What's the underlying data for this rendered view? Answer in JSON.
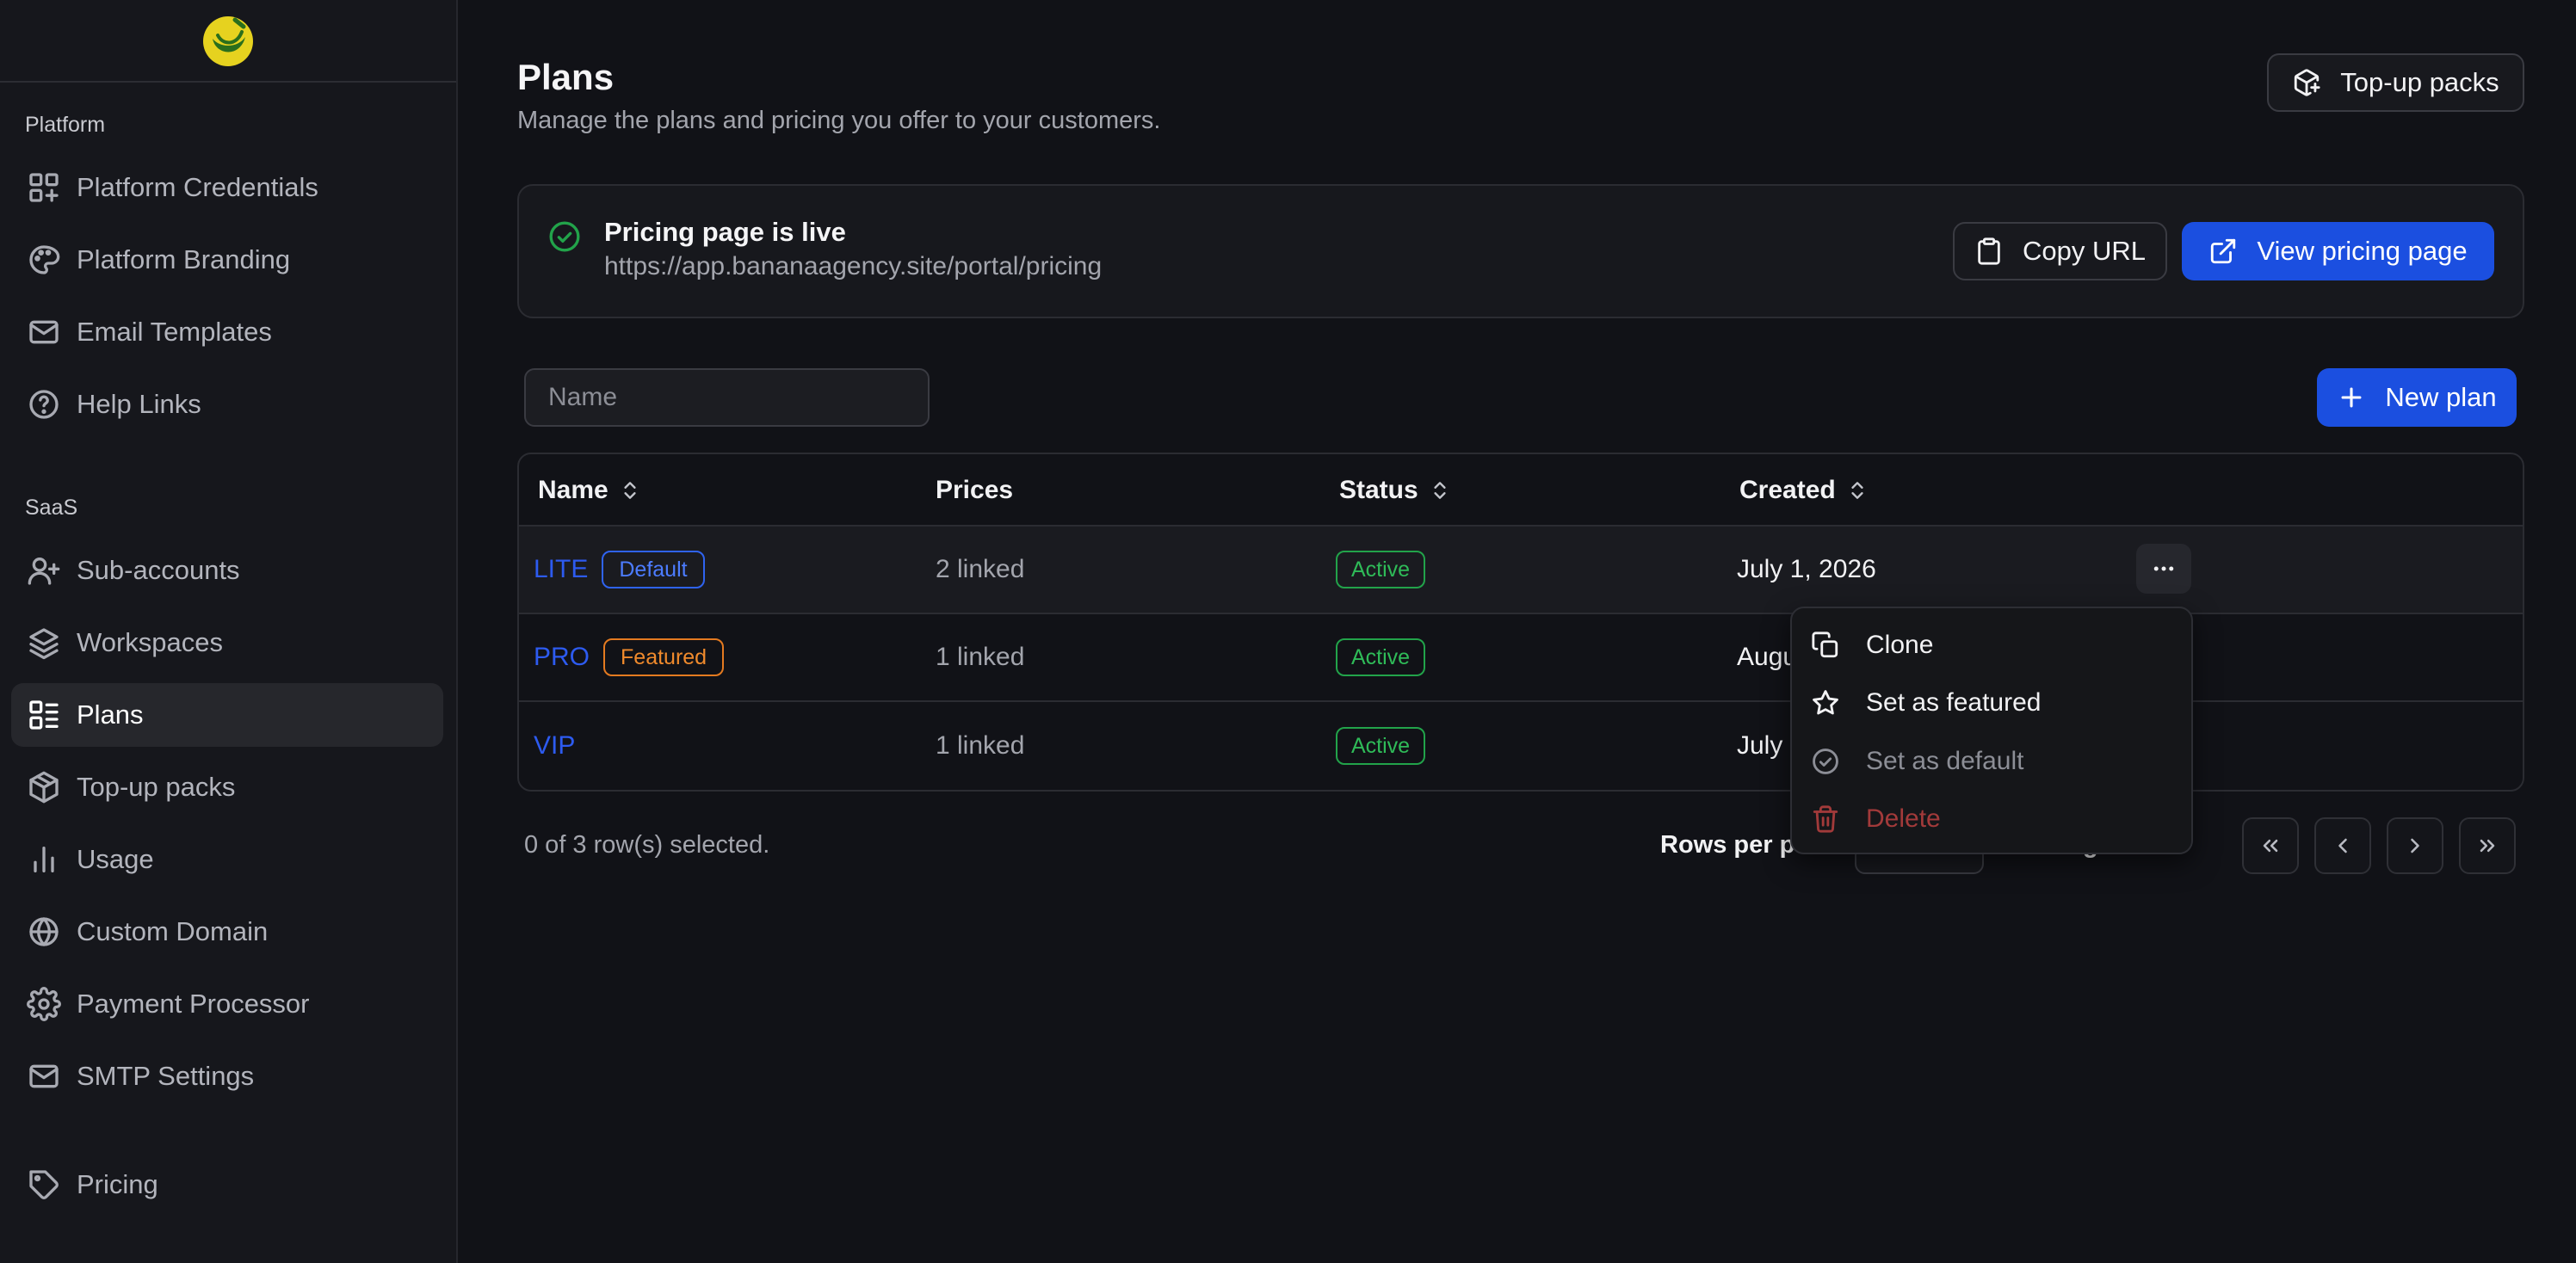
{
  "sidebar": {
    "logo_icon": "banana-logo-icon",
    "sections": [
      {
        "label": "Platform",
        "items": [
          {
            "label": "Platform Credentials",
            "icon": "grid-plus-icon"
          },
          {
            "label": "Platform Branding",
            "icon": "palette-icon"
          },
          {
            "label": "Email Templates",
            "icon": "mail-icon"
          },
          {
            "label": "Help Links",
            "icon": "help-circle-icon"
          }
        ]
      },
      {
        "label": "SaaS",
        "items": [
          {
            "label": "Sub-accounts",
            "icon": "user-plus-icon"
          },
          {
            "label": "Workspaces",
            "icon": "layers-icon"
          },
          {
            "label": "Plans",
            "icon": "list-icon",
            "active": true
          },
          {
            "label": "Top-up packs",
            "icon": "package-icon"
          },
          {
            "label": "Usage",
            "icon": "bar-chart-icon"
          },
          {
            "label": "Custom Domain",
            "icon": "globe-icon"
          },
          {
            "label": "Payment Processor",
            "icon": "gear-icon"
          },
          {
            "label": "SMTP Settings",
            "icon": "mail-icon"
          }
        ]
      }
    ],
    "bottom_item": {
      "label": "Pricing",
      "icon": "tag-icon"
    }
  },
  "header": {
    "title": "Plans",
    "subtitle": "Manage the plans and pricing you offer to your customers.",
    "topup_button": "Top-up packs"
  },
  "live_card": {
    "title": "Pricing page is live",
    "url": "https://app.bananaagency.site/portal/pricing",
    "copy_button": "Copy URL",
    "view_button": "View pricing page"
  },
  "search": {
    "placeholder": "Name",
    "value": ""
  },
  "new_plan_button": "New plan",
  "table": {
    "columns": [
      "Name",
      "Prices",
      "Status",
      "Created"
    ],
    "rows": [
      {
        "name": "LITE",
        "badge": "Default",
        "prices": "2 linked",
        "status": "Active",
        "created": "July 1, 2026"
      },
      {
        "name": "PRO",
        "badge": "Featured",
        "prices": "1 linked",
        "status": "Active",
        "created": "Augu"
      },
      {
        "name": "VIP",
        "badge": "",
        "prices": "1 linked",
        "status": "Active",
        "created": "July"
      }
    ]
  },
  "footer": {
    "selection": "0 of 3 row(s) selected.",
    "rows_per_page_label": "Rows per pa",
    "page_fragment": "g"
  },
  "row_menu": {
    "items": [
      {
        "label": "Clone",
        "icon": "copy-icon"
      },
      {
        "label": "Set as featured",
        "icon": "star-icon"
      },
      {
        "label": "Set as default",
        "icon": "check-circle-icon",
        "disabled": true
      },
      {
        "label": "Delete",
        "icon": "trash-icon",
        "danger": true
      }
    ]
  },
  "colors": {
    "background": "#111217",
    "sidebar": "#16171c",
    "primary": "#1b4fe0",
    "link": "#2d5bf0",
    "success": "#22a34a",
    "featured": "#e47a20",
    "danger": "#a23a3a"
  }
}
